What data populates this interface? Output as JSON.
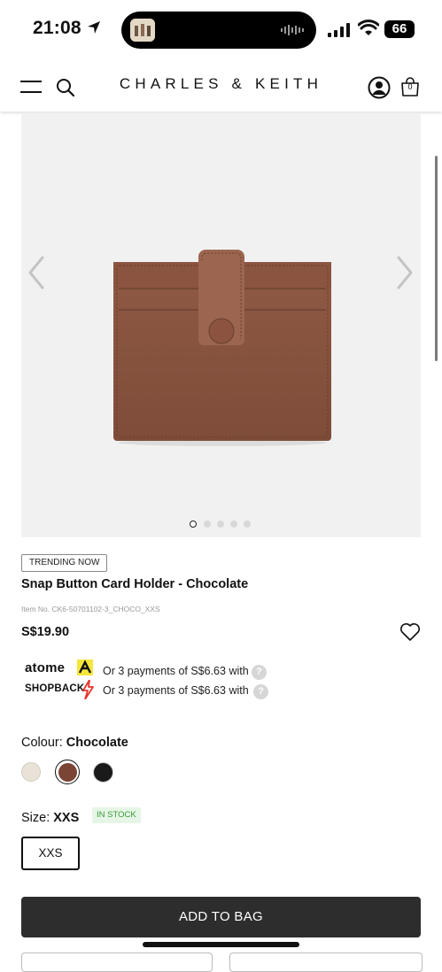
{
  "status_bar": {
    "time": "21:08",
    "battery": "66"
  },
  "header": {
    "brand": "CHARLES & KEITH",
    "bag_count": "0"
  },
  "product": {
    "badge": "TRENDING NOW",
    "title": "Snap Button Card Holder - Chocolate",
    "item_no": "Item No. CK6-50701102-3_CHOCO_XXS",
    "price": "S$19.90",
    "gallery": {
      "image_count": 5,
      "active_index": 1
    }
  },
  "payments": {
    "atome": {
      "logo": "atome",
      "text": "Or 3 payments of S$6.63 with"
    },
    "shopback": {
      "logo": "SHOPBACK",
      "text": "Or 3 payments of S$6.63 with"
    },
    "help_symbol": "?"
  },
  "colour": {
    "label": "Colour: ",
    "value": "Chocolate",
    "swatches": [
      {
        "name": "cream",
        "color": "#e9e2d7"
      },
      {
        "name": "chocolate",
        "color": "#7a4535",
        "selected": true
      },
      {
        "name": "black",
        "color": "#1a1a1a"
      }
    ]
  },
  "size": {
    "label": "Size: ",
    "value": "XXS",
    "stock": "IN STOCK",
    "options": [
      "XXS"
    ]
  },
  "actions": {
    "add_to_bag": "ADD TO BAG"
  },
  "colors": {
    "primary_button": "#2d2d2d",
    "in_stock_text": "#3a9a3a",
    "in_stock_bg": "#e6f6e6"
  }
}
